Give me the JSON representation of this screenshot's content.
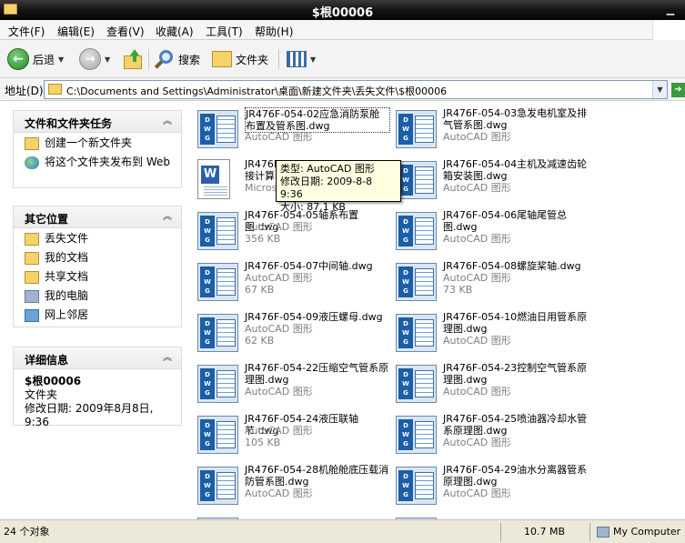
{
  "window": {
    "title": "$根00006"
  },
  "menu": [
    "文件(F)",
    "编辑(E)",
    "查看(V)",
    "收藏(A)",
    "工具(T)",
    "帮助(H)"
  ],
  "toolbar": {
    "back": "后退",
    "search": "搜索",
    "folders": "文件夹"
  },
  "address": {
    "label": "地址(D)",
    "path": "C:\\Documents and Settings\\Administrator\\桌面\\新建文件夹\\丢失文件\\$根00006"
  },
  "tasks": {
    "title": "文件和文件夹任务",
    "items": [
      {
        "label": "创建一个新文件夹"
      },
      {
        "label": "将这个文件夹发布到 Web"
      }
    ]
  },
  "places": {
    "title": "其它位置",
    "items": [
      {
        "label": "丢失文件"
      },
      {
        "label": "我的文档"
      },
      {
        "label": "共享文档"
      },
      {
        "label": "我的电脑"
      },
      {
        "label": "网上邻居"
      }
    ]
  },
  "details": {
    "title": "详细信息",
    "name": "$根00006",
    "type": "文件夹",
    "modified": "修改日期: 2009年8月8日, 9:36"
  },
  "files": [
    {
      "name": "JR476F-054-02应急消防泵舱布置及管系图.dwg",
      "type": "AutoCAD 图形",
      "size": ""
    },
    {
      "name": "JR476F-054-03急发电机室及排气管系图.dwg",
      "type": "AutoCAD 图形",
      "size": ""
    },
    {
      "name": "JR476F",
      "name2": "接计算",
      "type": "Microso",
      "size": ""
    },
    {
      "name": "JR476F-054-04主机及减速齿轮箱安装图.dwg",
      "type": "AutoCAD 图形",
      "size": ""
    },
    {
      "name": "JR476F-054-05轴系布置图.dwg",
      "type": "AutoCAD 图形",
      "size": "356 KB"
    },
    {
      "name": "JR476F-054-06尾轴尾管总图.dwg",
      "type": "AutoCAD 图形",
      "size": ""
    },
    {
      "name": "JR476F-054-07中间轴.dwg",
      "type": "AutoCAD 图形",
      "size": "67 KB"
    },
    {
      "name": "JR476F-054-08螺旋桨轴.dwg",
      "type": "AutoCAD 图形",
      "size": "73 KB"
    },
    {
      "name": "JR476F-054-09液压螺母.dwg",
      "type": "AutoCAD 图形",
      "size": "62 KB"
    },
    {
      "name": "JR476F-054-10燃油日用管系原理图.dwg",
      "type": "AutoCAD 图形",
      "size": ""
    },
    {
      "name": "JR476F-054-22压缩空气管系原理图.dwg",
      "type": "AutoCAD 图形",
      "size": ""
    },
    {
      "name": "JR476F-054-23控制空气管系原理图.dwg",
      "type": "AutoCAD 图形",
      "size": ""
    },
    {
      "name": "JR476F-054-24液压联轴节.dwg",
      "type": "AutoCAD 图形",
      "size": "105 KB"
    },
    {
      "name": "JR476F-054-25喷油器冷却水管系原理图.dwg",
      "type": "AutoCAD 图形",
      "size": ""
    },
    {
      "name": "JR476F-054-28机舱舱底压载消防管系图.dwg",
      "type": "AutoCAD 图形",
      "size": ""
    },
    {
      "name": "JR476F-054-29油水分离器管系原理图.dwg",
      "type": "AutoCAD 图形",
      "size": ""
    }
  ],
  "tooltip": {
    "type": "类型: AutoCAD 图形",
    "modified": "修改日期: 2009-8-8 9:36",
    "size": "大小: 87.1 KB"
  },
  "status": {
    "count": "24 个对象",
    "size": "10.7 MB",
    "location": "My Computer"
  }
}
